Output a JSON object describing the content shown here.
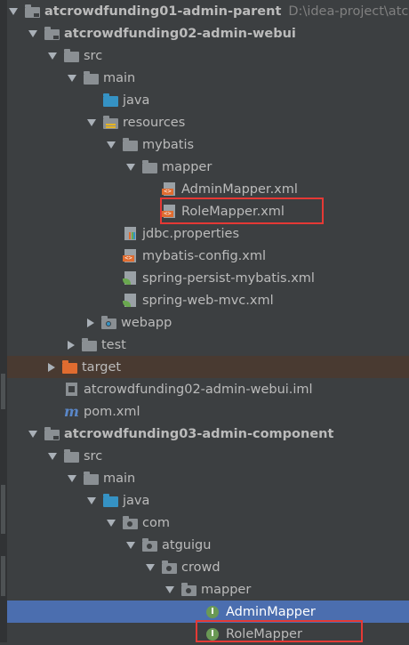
{
  "project_tree": {
    "rows": [
      {
        "label": "atcrowdfunding01-admin-parent",
        "path": "D:\\idea-project\\atcro"
      },
      {
        "label": "atcrowdfunding02-admin-webui"
      },
      {
        "label": "src"
      },
      {
        "label": "main"
      },
      {
        "label": "java"
      },
      {
        "label": "resources"
      },
      {
        "label": "mybatis"
      },
      {
        "label": "mapper"
      },
      {
        "label": "AdminMapper.xml"
      },
      {
        "label": "RoleMapper.xml"
      },
      {
        "label": "jdbc.properties"
      },
      {
        "label": "mybatis-config.xml"
      },
      {
        "label": "spring-persist-mybatis.xml"
      },
      {
        "label": "spring-web-mvc.xml"
      },
      {
        "label": "webapp"
      },
      {
        "label": "test"
      },
      {
        "label": "target"
      },
      {
        "label": "atcrowdfunding02-admin-webui.iml"
      },
      {
        "label": "pom.xml"
      },
      {
        "label": "atcrowdfunding03-admin-component"
      },
      {
        "label": "src"
      },
      {
        "label": "main"
      },
      {
        "label": "java"
      },
      {
        "label": "com"
      },
      {
        "label": "atguigu"
      },
      {
        "label": "crowd"
      },
      {
        "label": "mapper"
      },
      {
        "label": "AdminMapper"
      },
      {
        "label": "RoleMapper"
      }
    ]
  },
  "icons": {
    "xml_badge": "<>",
    "interface_badge": "I",
    "maven_badge": "m"
  },
  "colors": {
    "background": "#3c3f41",
    "selection": "#4b6eaf",
    "excluded_row": "#493a31",
    "highlight_box": "#e53935",
    "source_folder": "#3592c4",
    "excluded_folder": "#e06c30"
  }
}
